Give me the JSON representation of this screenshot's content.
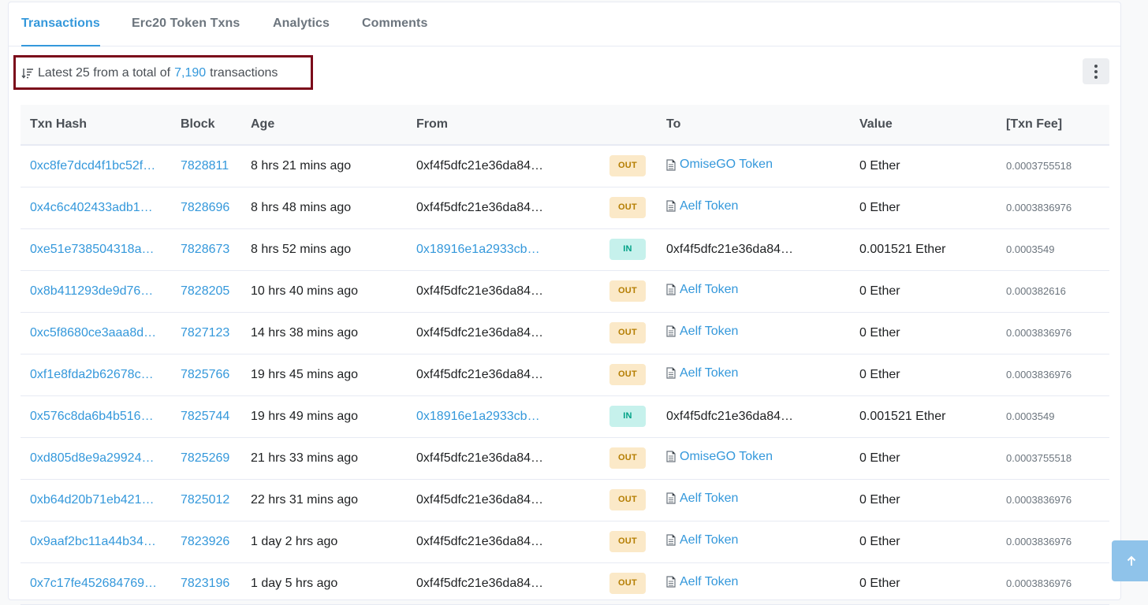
{
  "tabs": [
    {
      "label": "Transactions",
      "active": true
    },
    {
      "label": "Erc20 Token Txns",
      "active": false
    },
    {
      "label": "Analytics",
      "active": false
    },
    {
      "label": "Comments",
      "active": false
    }
  ],
  "summary": {
    "prefix": "Latest 25 from a total of",
    "count": "7,190",
    "suffix": "transactions"
  },
  "table": {
    "headers": [
      "Txn Hash",
      "Block",
      "Age",
      "From",
      "",
      "To",
      "Value",
      "[Txn Fee]"
    ],
    "rows": [
      {
        "hash": "0xc8fe7dcd4f1bc52f…",
        "block": "7828811",
        "age": "8 hrs 21 mins ago",
        "from": "0xf4f5dfc21e36da84…",
        "from_link": false,
        "dir": "OUT",
        "to": "OmiseGO Token",
        "to_contract": true,
        "value": "0 Ether",
        "fee": "0.0003755518"
      },
      {
        "hash": "0x4c6c402433adb1…",
        "block": "7828696",
        "age": "8 hrs 48 mins ago",
        "from": "0xf4f5dfc21e36da84…",
        "from_link": false,
        "dir": "OUT",
        "to": "Aelf Token",
        "to_contract": true,
        "value": "0 Ether",
        "fee": "0.0003836976"
      },
      {
        "hash": "0xe51e738504318a…",
        "block": "7828673",
        "age": "8 hrs 52 mins ago",
        "from": "0x18916e1a2933cb…",
        "from_link": true,
        "dir": "IN",
        "to": "0xf4f5dfc21e36da84…",
        "to_contract": false,
        "value": "0.001521 Ether",
        "fee": "0.0003549"
      },
      {
        "hash": "0x8b411293de9d76…",
        "block": "7828205",
        "age": "10 hrs 40 mins ago",
        "from": "0xf4f5dfc21e36da84…",
        "from_link": false,
        "dir": "OUT",
        "to": "Aelf Token",
        "to_contract": true,
        "value": "0 Ether",
        "fee": "0.000382616"
      },
      {
        "hash": "0xc5f8680ce3aaa8d…",
        "block": "7827123",
        "age": "14 hrs 38 mins ago",
        "from": "0xf4f5dfc21e36da84…",
        "from_link": false,
        "dir": "OUT",
        "to": "Aelf Token",
        "to_contract": true,
        "value": "0 Ether",
        "fee": "0.0003836976"
      },
      {
        "hash": "0xf1e8fda2b62678c…",
        "block": "7825766",
        "age": "19 hrs 45 mins ago",
        "from": "0xf4f5dfc21e36da84…",
        "from_link": false,
        "dir": "OUT",
        "to": "Aelf Token",
        "to_contract": true,
        "value": "0 Ether",
        "fee": "0.0003836976"
      },
      {
        "hash": "0x576c8da6b4b516…",
        "block": "7825744",
        "age": "19 hrs 49 mins ago",
        "from": "0x18916e1a2933cb…",
        "from_link": true,
        "dir": "IN",
        "to": "0xf4f5dfc21e36da84…",
        "to_contract": false,
        "value": "0.001521 Ether",
        "fee": "0.0003549"
      },
      {
        "hash": "0xd805d8e9a29924…",
        "block": "7825269",
        "age": "21 hrs 33 mins ago",
        "from": "0xf4f5dfc21e36da84…",
        "from_link": false,
        "dir": "OUT",
        "to": "OmiseGO Token",
        "to_contract": true,
        "value": "0 Ether",
        "fee": "0.0003755518"
      },
      {
        "hash": "0xb64d20b71eb421…",
        "block": "7825012",
        "age": "22 hrs 31 mins ago",
        "from": "0xf4f5dfc21e36da84…",
        "from_link": false,
        "dir": "OUT",
        "to": "Aelf Token",
        "to_contract": true,
        "value": "0 Ether",
        "fee": "0.0003836976"
      },
      {
        "hash": "0x9aaf2bc11a44b34…",
        "block": "7823926",
        "age": "1 day 2 hrs ago",
        "from": "0xf4f5dfc21e36da84…",
        "from_link": false,
        "dir": "OUT",
        "to": "Aelf Token",
        "to_contract": true,
        "value": "0 Ether",
        "fee": "0.0003836976"
      },
      {
        "hash": "0x7c17fe452684769…",
        "block": "7823196",
        "age": "1 day 5 hrs ago",
        "from": "0xf4f5dfc21e36da84…",
        "from_link": false,
        "dir": "OUT",
        "to": "Aelf Token",
        "to_contract": true,
        "value": "0 Ether",
        "fee": "0.0003836976"
      }
    ]
  },
  "icons": {
    "sort": "sort-descending-icon",
    "menu": "vertical-dots-icon",
    "contract": "document-icon",
    "scroll_top": "arrow-up-icon"
  },
  "colors": {
    "link": "#3498db",
    "out_badge_bg": "#fbe9c8",
    "out_badge_text": "#b47d00",
    "in_badge_bg": "#c6f1ec",
    "in_badge_text": "#00a186",
    "highlight_box": "#7b0a1a"
  }
}
